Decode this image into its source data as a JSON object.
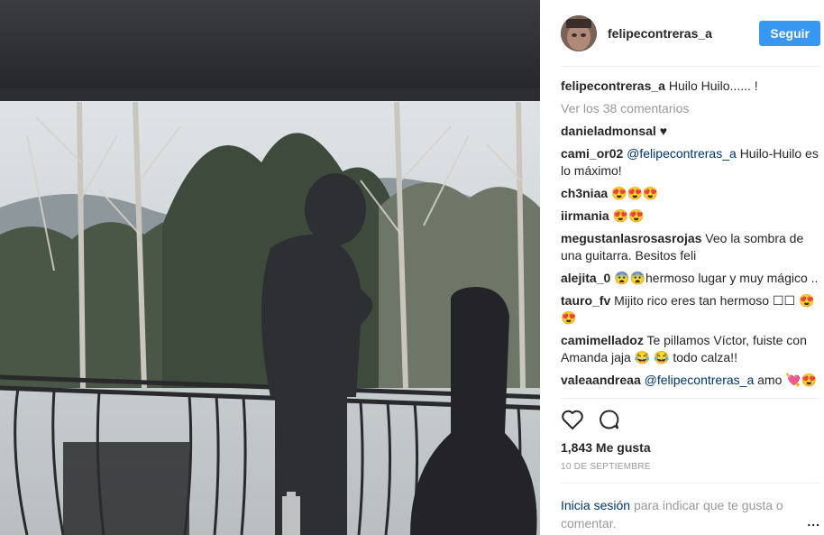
{
  "photo": {
    "alt_icon": "photo-silhouette"
  },
  "header": {
    "username": "felipecontreras_a",
    "follow_label": "Seguir"
  },
  "caption": {
    "user": "felipecontreras_a",
    "text": "Huilo Huilo...... !"
  },
  "view_comments": "Ver los 38 comentarios",
  "comments": [
    {
      "user": "danieladmonsal",
      "pre": "",
      "mention": "",
      "text": "♥"
    },
    {
      "user": "cami_or02",
      "pre": "",
      "mention": "@felipecontreras_a",
      "text": "Huilo-Huilo es lo máximo!"
    },
    {
      "user": "ch3niaa",
      "pre": "",
      "mention": "",
      "text": "😍😍😍"
    },
    {
      "user": "iirmania",
      "pre": "",
      "mention": "",
      "text": "😍😍"
    },
    {
      "user": "megustanlasrosasrojas",
      "pre": "",
      "mention": "",
      "text": "Veo la sombra de una guitarra. Besitos feli"
    },
    {
      "user": "alejita_0",
      "pre": "",
      "mention": "",
      "text": "😨😨hermoso lugar y muy mágico .."
    },
    {
      "user": "tauro_fv",
      "pre": "",
      "mention": "",
      "text": "Mijito rico eres tan hermoso ☐☐ 😍😍"
    },
    {
      "user": "camimelladoz",
      "pre": "",
      "mention": "",
      "text": "Te pillamos Víctor, fuiste con Amanda jaja 😂 😂 todo calza!!"
    },
    {
      "user": "valeaandreaa",
      "pre": "",
      "mention": "@felipecontreras_a",
      "text": "amo 💘😍"
    }
  ],
  "actions": {
    "like_icon": "heart-outline",
    "comment_icon": "speech-bubble"
  },
  "likes": "1,843 Me gusta",
  "date": "10 DE SEPTIEMBRE",
  "login": {
    "link": "Inicia sesión",
    "text": "para indicar que te gusta o comentar.",
    "more": "..."
  }
}
